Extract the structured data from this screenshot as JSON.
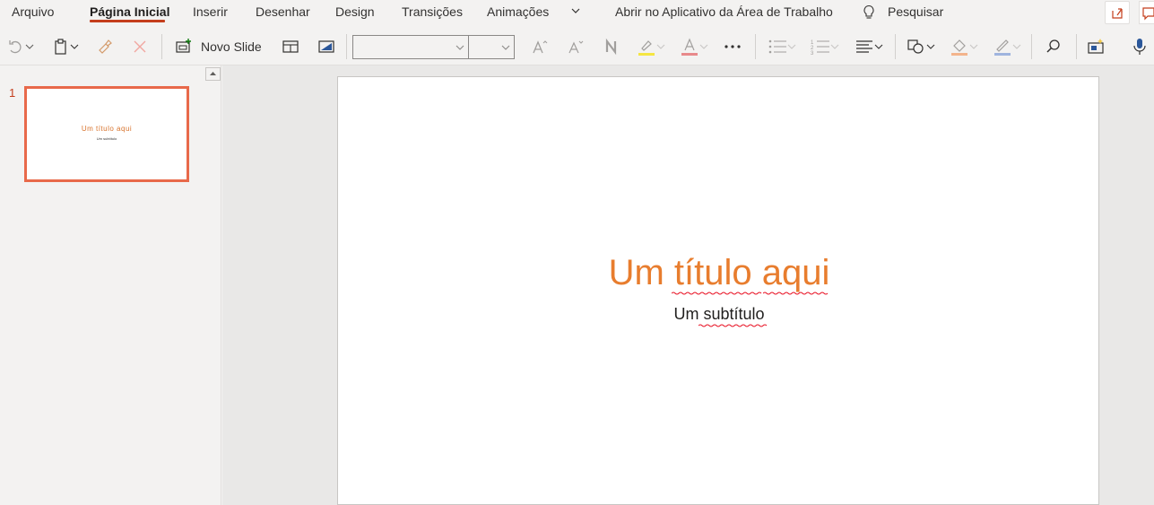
{
  "tabs": {
    "items": [
      "Arquivo",
      "Página Inicial",
      "Inserir",
      "Desenhar",
      "Design",
      "Transições",
      "Animações"
    ],
    "open_desktop": "Abrir no Aplicativo da Área de Trabalho",
    "search": "Pesquisar"
  },
  "ribbon": {
    "new_slide_label": "Novo Slide",
    "font_name_value": "",
    "font_size_value": ""
  },
  "thumbnails": {
    "slide_number": "1",
    "title_preview": "Um título aqui",
    "subtitle_preview": "Um subtítulo"
  },
  "slide": {
    "title": "Um título aqui",
    "subtitle": "Um subtítulo"
  },
  "colors": {
    "accent": "#c43e1c",
    "title": "#e87d2e",
    "selection_border": "#e8694a"
  },
  "icons": [
    "undo-icon",
    "paste-icon",
    "format-painter-icon",
    "clear-formatting-icon",
    "new-slide-icon",
    "layout-icon",
    "design-icon",
    "increase-font-icon",
    "decrease-font-icon",
    "bold-icon",
    "highlight-icon",
    "font-color-icon",
    "more-icon",
    "bullets-icon",
    "numbering-icon",
    "align-icon",
    "shapes-icon",
    "fill-icon",
    "outline-icon",
    "find-icon",
    "designer-icon",
    "dictate-icon",
    "lightbulb-icon",
    "share-icon"
  ]
}
